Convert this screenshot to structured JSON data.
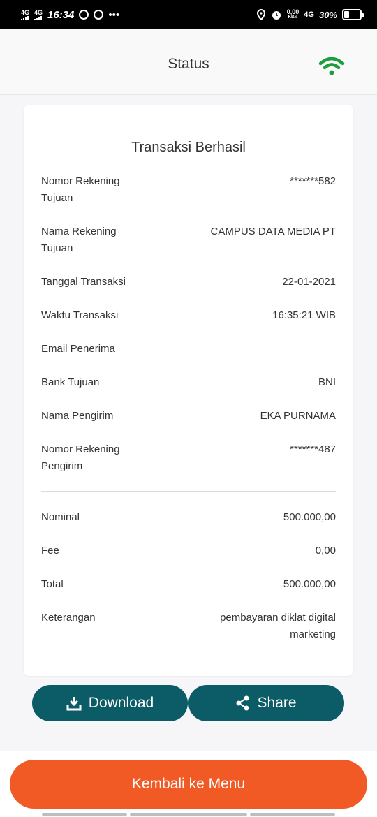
{
  "status_bar": {
    "network_1": "4G",
    "network_2": "4G",
    "time": "16:34",
    "more": "•••",
    "speed_value": "0,00",
    "speed_unit": "KB/s",
    "network_3": "4G",
    "battery": "30%",
    "icons": [
      "whatsapp-icon",
      "chrome-icon",
      "location-icon",
      "alarm-icon",
      "battery-icon"
    ]
  },
  "app_bar": {
    "title": "Status",
    "wifi_icon": "wifi-icon",
    "wifi_color": "#1e9e3a"
  },
  "receipt": {
    "title": "Transaksi Berhasil",
    "rows": [
      {
        "label": "Nomor Rekening Tujuan",
        "value": "*******582"
      },
      {
        "label": "Nama Rekening Tujuan",
        "value": "CAMPUS DATA MEDIA PT"
      },
      {
        "label": "Tanggal Transaksi",
        "value": "22-01-2021"
      },
      {
        "label": "Waktu Transaksi",
        "value": "16:35:21 WIB"
      },
      {
        "label": "Email Penerima",
        "value": ""
      },
      {
        "label": "Bank Tujuan",
        "value": "BNI"
      },
      {
        "label": "Nama Pengirim",
        "value": "EKA PURNAMA"
      },
      {
        "label": "Nomor Rekening Pengirim",
        "value": "*******487"
      }
    ],
    "totals": [
      {
        "label": "Nominal",
        "value": "500.000,00"
      },
      {
        "label": "Fee",
        "value": "0,00"
      },
      {
        "label": "Total",
        "value": "500.000,00"
      },
      {
        "label": "Keterangan",
        "value": "pembayaran diklat digital marketing"
      }
    ]
  },
  "actions": {
    "download_label": "Download",
    "share_label": "Share",
    "back_label": "Kembali ke Menu"
  },
  "colors": {
    "primary_button": "#0c5c68",
    "accent_button": "#f15a24"
  }
}
